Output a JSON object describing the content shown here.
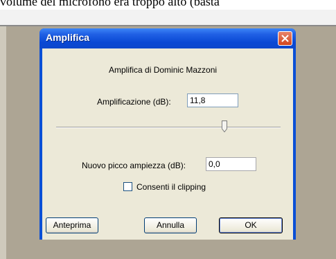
{
  "background": {
    "top_text": "volume del microfono era troppo alto (basta"
  },
  "dialog": {
    "title": "Amplifica",
    "subtitle": "Amplifica di Dominic Mazzoni",
    "amplification": {
      "label": "Amplificazione (dB):",
      "value": "11,8"
    },
    "slider": {
      "level": 0.75
    },
    "peak": {
      "label": "Nuovo picco ampiezza (dB):",
      "value": "0,0"
    },
    "clipping": {
      "label": "Consenti il clipping",
      "checked": false
    },
    "buttons": {
      "preview": "Anteprima",
      "cancel": "Annulla",
      "ok": "OK"
    }
  },
  "colors": {
    "titlebar": "#0a48d4",
    "face": "#ece9d8",
    "close": "#d2451d"
  }
}
